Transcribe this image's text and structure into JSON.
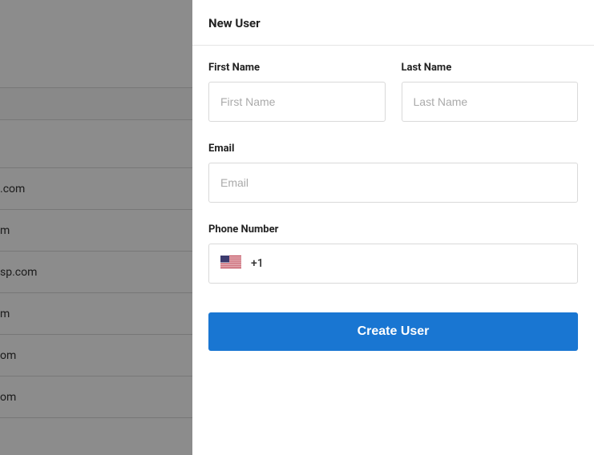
{
  "panel": {
    "title": "New User",
    "firstName": {
      "label": "First Name",
      "placeholder": "First Name"
    },
    "lastName": {
      "label": "Last Name",
      "placeholder": "Last Name"
    },
    "email": {
      "label": "Email",
      "placeholder": "Email"
    },
    "phone": {
      "label": "Phone Number",
      "dial": "+1"
    },
    "submit": "Create User"
  },
  "background": {
    "rows": [
      ".com",
      "m",
      "sp.com",
      "m",
      "om",
      "om"
    ]
  }
}
